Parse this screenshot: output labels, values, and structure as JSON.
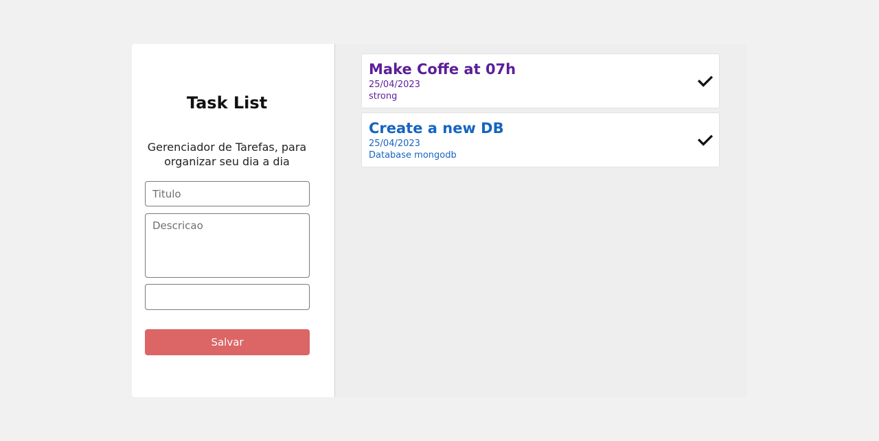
{
  "form": {
    "title": "Task List",
    "subtitle": "Gerenciador de Tarefas, para organizar seu dia a dia",
    "title_placeholder": "Titulo",
    "description_placeholder": "Descricao",
    "extra_value": "",
    "save_label": "Salvar"
  },
  "tasks": [
    {
      "title": "Make Coffe at 07h",
      "date": "25/04/2023",
      "description": "strong",
      "color": "#5b1e9a"
    },
    {
      "title": "Create a new DB",
      "date": "25/04/2023",
      "description": "Database mongodb",
      "color": "#1565c0"
    }
  ],
  "colors": {
    "accent_button": "#dc6565",
    "page_background": "#f1f1f1",
    "list_background": "#eeeeee"
  }
}
